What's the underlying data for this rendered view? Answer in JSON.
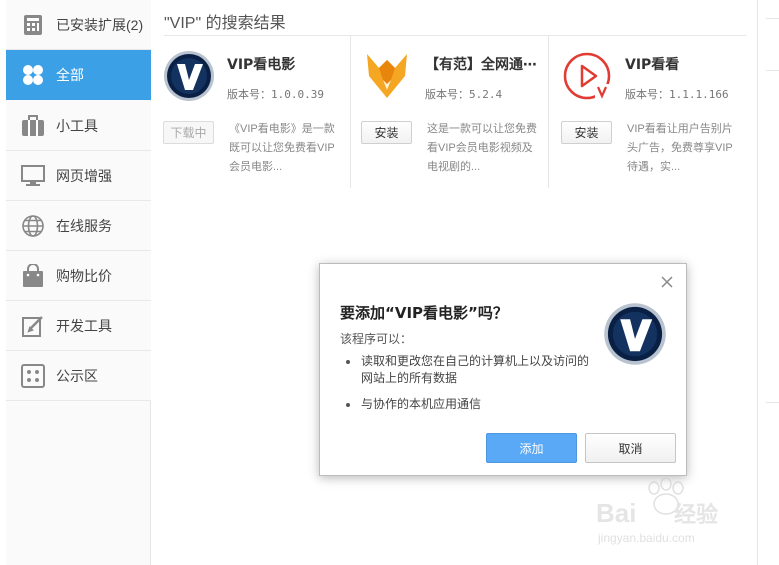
{
  "sidebar": {
    "items": [
      {
        "label": "已安装扩展(2)",
        "icon": "installed-icon",
        "active": false
      },
      {
        "label": "全部",
        "icon": "all-grid-icon",
        "active": true
      },
      {
        "label": "小工具",
        "icon": "toolbox-icon",
        "active": false
      },
      {
        "label": "网页增强",
        "icon": "monitor-icon",
        "active": false
      },
      {
        "label": "在线服务",
        "icon": "globe-icon",
        "active": false
      },
      {
        "label": "购物比价",
        "icon": "shopping-bag-icon",
        "active": false
      },
      {
        "label": "开发工具",
        "icon": "edit-icon",
        "active": false
      },
      {
        "label": "公示区",
        "icon": "dots-grid-icon",
        "active": false
      }
    ]
  },
  "main": {
    "results_title": "\"VIP\" 的搜索结果",
    "cards": [
      {
        "name": "VIP看电影",
        "version": "版本号：1.0.0.39",
        "button": "下载中",
        "button_disabled": true,
        "description": "《VIP看电影》是一款既可以让您免费看VIP会员电影...",
        "logo": "vip-movie-logo-icon"
      },
      {
        "name": "【有范】全网通⋯",
        "version": "版本号：5.2.4",
        "button": "安装",
        "button_disabled": false,
        "description": "这是一款可以让您免费看VIP会员电影视频及电视剧的...",
        "logo": "youfan-fox-logo-icon"
      },
      {
        "name": "VIP看看",
        "version": "版本号：1.1.1.166",
        "button": "安装",
        "button_disabled": false,
        "description": "VIP看看让用户告别片头广告，免费尊享VIP待遇，实...",
        "logo": "vip-kankan-play-logo-icon"
      }
    ]
  },
  "dialog": {
    "title": "要添加“VIP看电影”吗？",
    "subtitle": "该程序可以：",
    "permissions": [
      "读取和更改您在自己的计算机上以及访问的网站上的所有数据",
      "与协作的本机应用通信"
    ],
    "add_label": "添加",
    "cancel_label": "取消",
    "logo": "vip-movie-logo-icon"
  },
  "watermark": {
    "brand": "Baidu经验",
    "url": "jingyan.baidu.com"
  },
  "colors": {
    "accent": "#3ba0e6",
    "add_button": "#5aa9f6",
    "vip_logo": "#0a1f44",
    "fox_logo": "#f39c12",
    "play_logo": "#e03c31"
  }
}
